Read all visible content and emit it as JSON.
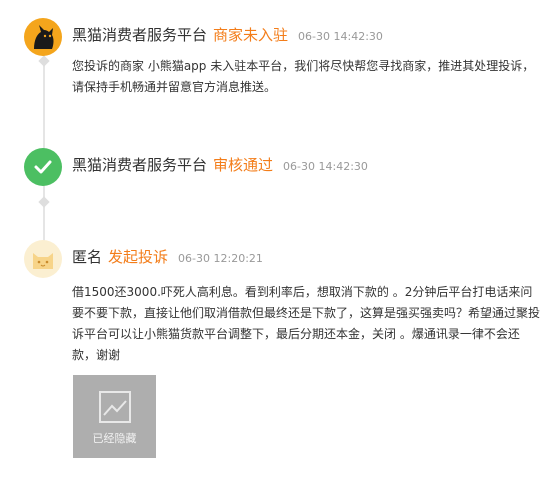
{
  "events": [
    {
      "name": "黑猫消费者服务平台",
      "status": "商家未入驻",
      "time": "06-30 14:42:30",
      "avatar_icon": "black-cat-logo-icon",
      "text": "您投诉的商家 小熊猫app 未入驻本平台，我们将尽快帮您寻找商家，推进其处理投诉，请保持手机畅通并留意官方消息推送。"
    },
    {
      "name": "黑猫消费者服务平台",
      "status": "审核通过",
      "time": "06-30 14:42:30",
      "avatar_icon": "check-icon"
    },
    {
      "name": "匿名",
      "status": "发起投诉",
      "time": "06-30 12:20:21",
      "avatar_icon": "anonymous-cat-icon",
      "text": "借1500还3000.吓死人高利息。看到利率后，想取消下款的 。2分钟后平台打电话来问要不要下款，直接让他们取消借款但最终还是下款了，这算是强买强卖吗？希望通过聚投诉平台可以让小熊猫货款平台调整下，最后分期还本金，关闭 。爆通讯录一律不会还款，谢谢",
      "attachment": {
        "label": "已经隐藏",
        "icon": "image-placeholder-icon"
      }
    }
  ],
  "colors": {
    "status": "#f37d1a",
    "cat_avatar": "#f4a51c",
    "check_avatar": "#4cbf62",
    "anon_avatar": "#fbefd1",
    "hidden_image": "#aeaeae"
  }
}
